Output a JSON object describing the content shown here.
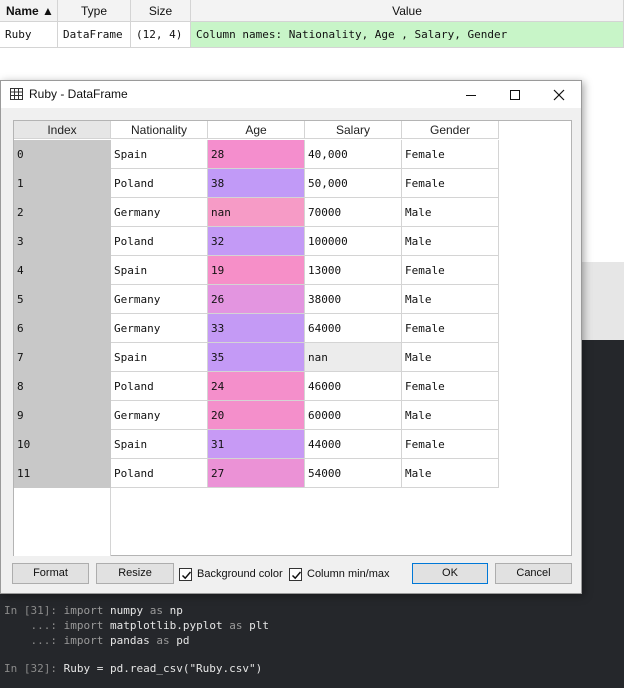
{
  "variable_explorer": {
    "headers": {
      "name": "Name ▲",
      "type": "Type",
      "size": "Size",
      "value": "Value"
    },
    "row": {
      "name": "Ruby",
      "type": "DataFrame",
      "size": "(12, 4)",
      "value": "Column names: Nationality, Age , Salary, Gender"
    },
    "value_highlight_color": "#c8f5c8"
  },
  "dialog": {
    "title": "Ruby - DataFrame",
    "icons": {
      "title": "table-icon",
      "minimize": "minimize-icon",
      "maximize": "maximize-icon",
      "close": "close-icon"
    },
    "columns": [
      "Index",
      "Nationality",
      "Age",
      "Salary",
      "Gender"
    ],
    "rows": [
      {
        "index": "0",
        "nationality": "Spain",
        "age": "28",
        "salary": "40,000",
        "gender": "Female",
        "age_color": "#f48ecd"
      },
      {
        "index": "1",
        "nationality": "Poland",
        "age": "38",
        "salary": "50,000",
        "gender": "Female",
        "age_color": "#c19af7"
      },
      {
        "index": "2",
        "nationality": "Germany",
        "age": "nan",
        "salary": "70000",
        "gender": "Male",
        "age_color": "#f69bc6"
      },
      {
        "index": "3",
        "nationality": "Poland",
        "age": "32",
        "salary": "100000",
        "gender": "Male",
        "age_color": "#c39af6"
      },
      {
        "index": "4",
        "nationality": "Spain",
        "age": "19",
        "salary": "13000",
        "gender": "Female",
        "age_color": "#f68fc8"
      },
      {
        "index": "5",
        "nationality": "Germany",
        "age": "26",
        "salary": "38000",
        "gender": "Male",
        "age_color": "#e395e0"
      },
      {
        "index": "6",
        "nationality": "Germany",
        "age": "33",
        "salary": "64000",
        "gender": "Female",
        "age_color": "#c49af5"
      },
      {
        "index": "7",
        "nationality": "Spain",
        "age": "35",
        "salary": "nan",
        "gender": "Male",
        "age_color": "#c49af6"
      },
      {
        "index": "8",
        "nationality": "Poland",
        "age": "24",
        "salary": "46000",
        "gender": "Female",
        "age_color": "#f48fcb"
      },
      {
        "index": "9",
        "nationality": "Germany",
        "age": "20",
        "salary": "60000",
        "gender": "Male",
        "age_color": "#f48fcb"
      },
      {
        "index": "10",
        "nationality": "Spain",
        "age": "31",
        "salary": "44000",
        "gender": "Female",
        "age_color": "#c79af5"
      },
      {
        "index": "11",
        "nationality": "Poland",
        "age": "27",
        "salary": "54000",
        "gender": "Male",
        "age_color": "#eb92d6"
      }
    ],
    "buttons": {
      "format": "Format",
      "resize": "Resize",
      "background_color": "Background color",
      "column_minmax": "Column min/max",
      "ok": "OK",
      "cancel": "Cancel"
    },
    "checkboxes": {
      "background_color_checked": true,
      "column_minmax_checked": true
    }
  },
  "console": {
    "lines": [
      {
        "prompt": "In [31]: ",
        "code": "import numpy as np"
      },
      {
        "prompt": "    ...: ",
        "code": "import matplotlib.pyplot as plt"
      },
      {
        "prompt": "    ...: ",
        "code": "import pandas as pd"
      },
      {
        "prompt": "In [32]: ",
        "code": "Ruby = pd.read_csv(\"Ruby.csv\")"
      }
    ]
  }
}
